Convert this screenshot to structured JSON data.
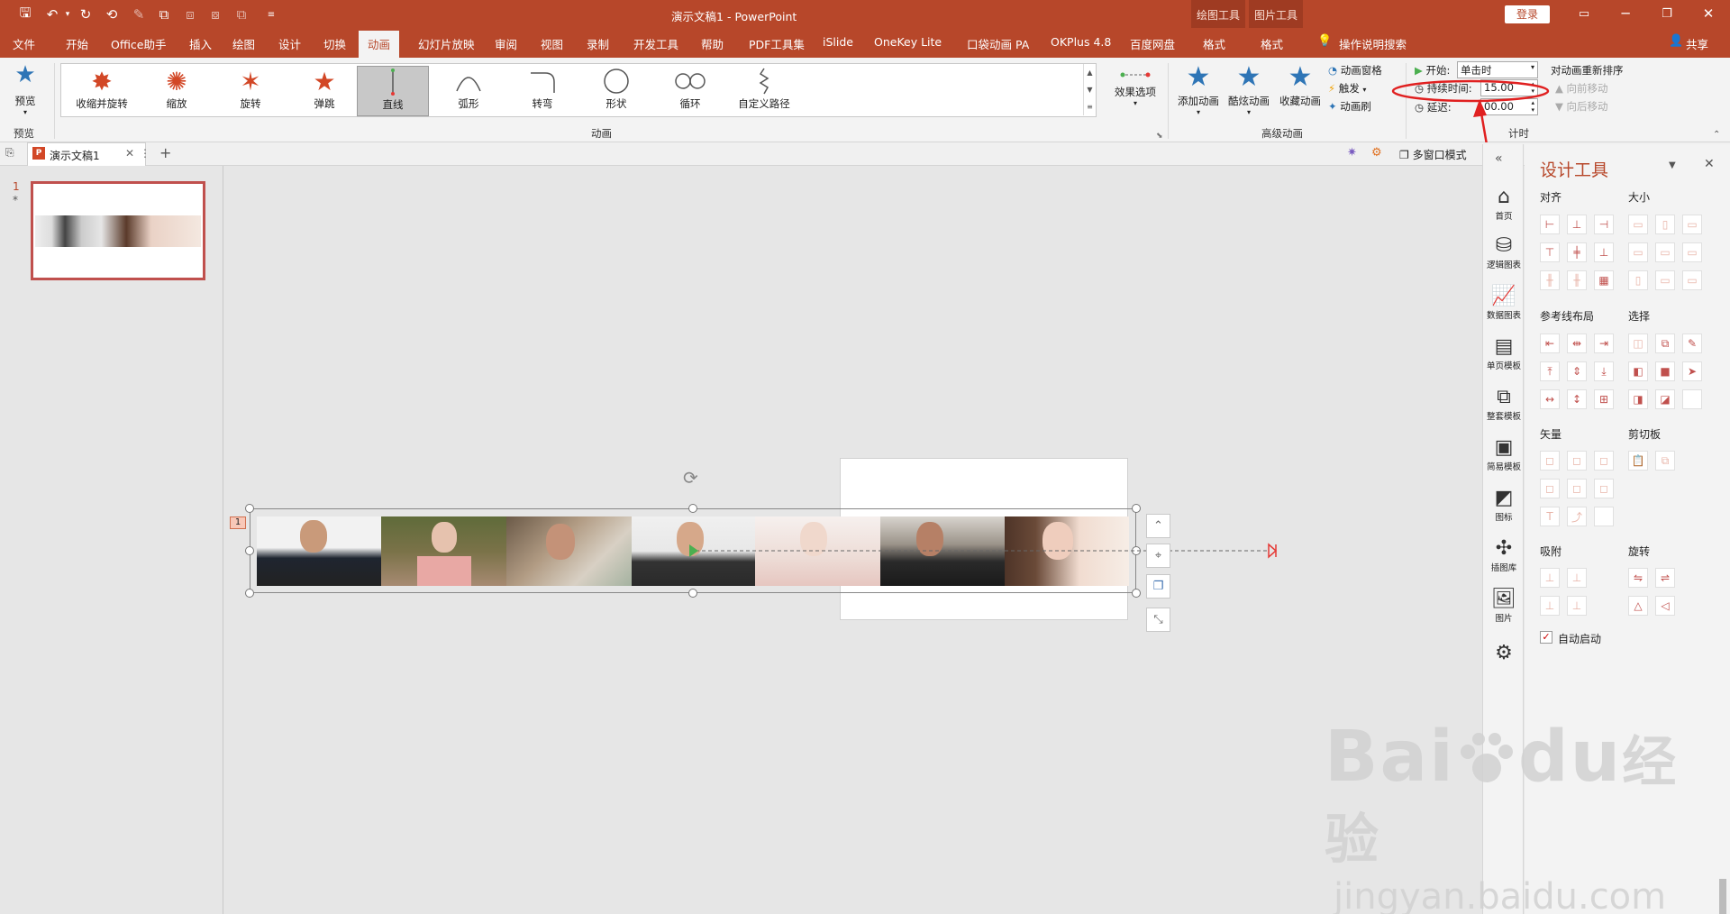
{
  "title": {
    "doc": "演示文稿1",
    "sep": "-",
    "app": "PowerPoint",
    "ctx_drawing": "绘图工具",
    "ctx_picture": "图片工具",
    "login": "登录"
  },
  "menu": [
    "文件",
    "开始",
    "Office助手",
    "插入",
    "绘图",
    "设计",
    "切换",
    "动画",
    "幻灯片放映",
    "审阅",
    "视图",
    "录制",
    "开发工具",
    "帮助",
    "PDF工具集",
    "iSlide",
    "OneKey Lite",
    "口袋动画 PA",
    "OKPlus 4.8",
    "百度网盘"
  ],
  "menu_active": "动画",
  "ctx_tabs": [
    "格式",
    "格式"
  ],
  "tell_me": "操作说明搜索",
  "share": "共享",
  "ribbon": {
    "preview_label": "预览",
    "preview_group": "预览",
    "gallery": [
      "收缩并旋转",
      "缩放",
      "旋转",
      "弹跳",
      "直线",
      "弧形",
      "转弯",
      "形状",
      "循环",
      "自定义路径"
    ],
    "gallery_selected": "直线",
    "effect_options": "效果选项",
    "animation_group": "动画",
    "add_animation": "添加动画",
    "cool_animation": "酷炫动画",
    "fav_animation": "收藏动画",
    "anim_pane": "动画窗格",
    "trigger": "触发",
    "anim_painter": "动画刷",
    "advanced_group": "高级动画",
    "start_label": "开始:",
    "start_value": "单击时",
    "duration_label": "持续时间:",
    "duration_value": "15.00",
    "delay_label": "延迟:",
    "delay_value": "00.00",
    "reorder": "对动画重新排序",
    "move_earlier": "向前移动",
    "move_later": "向后移动",
    "timing_group": "计时"
  },
  "doctab": {
    "name": "演示文稿1",
    "multi_window": "多窗口模式"
  },
  "thumb": {
    "num": "1",
    "star": "*"
  },
  "anim_tag": "1",
  "side_tools": [
    "首页",
    "逻辑图表",
    "数据图表",
    "单页模板",
    "整套模板",
    "简易模板",
    "图标",
    "插图库",
    "图片"
  ],
  "design": {
    "title": "设计工具",
    "align": "对齐",
    "size": "大小",
    "guide_layout": "参考线布局",
    "select": "选择",
    "vector": "矢量",
    "clipboard": "剪切板",
    "snap": "吸附",
    "rotate": "旋转",
    "autostart": "自动启动"
  },
  "watermark": {
    "brand": "Bai",
    "brand2": "du",
    "cn": "经验",
    "url": "jingyan.baidu.com"
  },
  "colors": {
    "accent": "#b7472a",
    "annotation": "#e02020"
  }
}
